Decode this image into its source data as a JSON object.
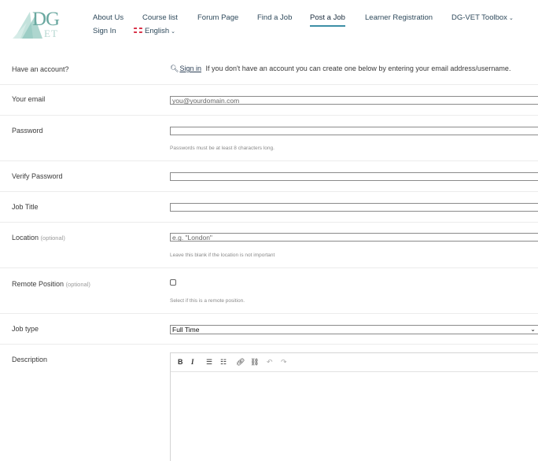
{
  "logo": {
    "text_top": "DG",
    "text_bottom": "ET"
  },
  "nav": {
    "row1": [
      "About Us",
      "Course list",
      "Forum Page",
      "Find a Job",
      "Post a Job",
      "Learner Registration",
      "DG-VET Toolbox"
    ],
    "row2": {
      "sign_in": "Sign In",
      "language": "English"
    },
    "active": "Post a Job"
  },
  "form": {
    "account": {
      "label": "Have an account?",
      "signin_link": "Sign in",
      "text": "If you don't have an account you can create one below by entering your email address/username."
    },
    "email": {
      "label": "Your email",
      "placeholder": "you@yourdomain.com"
    },
    "password": {
      "label": "Password",
      "hint": "Passwords must be at least 8 characters long."
    },
    "verify_password": {
      "label": "Verify Password"
    },
    "job_title": {
      "label": "Job Title"
    },
    "location": {
      "label": "Location",
      "optional": "(optional)",
      "placeholder": "e.g. \"London\"",
      "hint": "Leave this blank if the location is not important"
    },
    "remote": {
      "label": "Remote Position",
      "optional": "(optional)",
      "hint": "Select if this is a remote position.",
      "checked": false
    },
    "job_type": {
      "label": "Job type",
      "selected": "Full Time"
    },
    "description": {
      "label": "Description"
    }
  },
  "editor_toolbar": {
    "bold": "B",
    "italic": "I"
  },
  "colors": {
    "accent": "#3d8fa6",
    "nav_text": "#2f4a5c",
    "logo": "#7fb8b0"
  }
}
